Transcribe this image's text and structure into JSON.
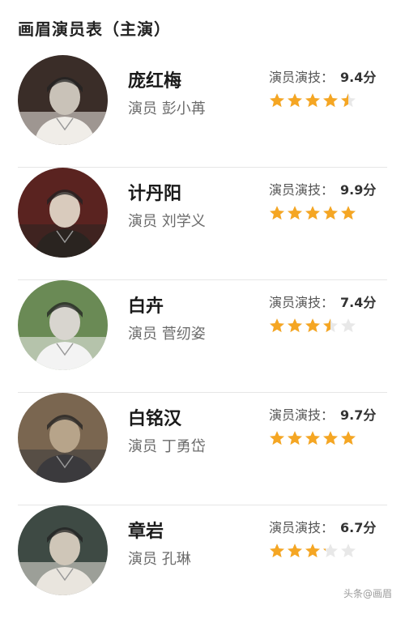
{
  "page": {
    "title": "画眉演员表（主演）"
  },
  "cast": [
    {
      "role": "庞红梅",
      "actor_prefix": "演员",
      "actor": "彭小苒",
      "rating_label": "演员演技：",
      "rating": "9.4分",
      "stars": 4.5,
      "avatar_colors": [
        "#3a2d28",
        "#f0ede8",
        "#c9c2b8"
      ],
      "avatar_icon": "portrait-nurse-icon"
    },
    {
      "role": "计丹阳",
      "actor_prefix": "演员",
      "actor": "刘学义",
      "rating_label": "演员演技：",
      "rating": "9.9分",
      "stars": 5,
      "avatar_colors": [
        "#5a2320",
        "#2a2420",
        "#d9cbbd"
      ],
      "avatar_icon": "portrait-man-icon"
    },
    {
      "role": "白卉",
      "actor_prefix": "演员",
      "actor": "菅纫姿",
      "rating_label": "演员演技：",
      "rating": "7.4分",
      "stars": 3.5,
      "avatar_colors": [
        "#6a8a55",
        "#f3f3f3",
        "#d8d5cf"
      ],
      "avatar_icon": "portrait-nurse-icon"
    },
    {
      "role": "白铭汉",
      "actor_prefix": "演员",
      "actor": "丁勇岱",
      "rating_label": "演员演技：",
      "rating": "9.7分",
      "stars": 5,
      "avatar_colors": [
        "#7a6650",
        "#3b3a3d",
        "#b7a48a"
      ],
      "avatar_icon": "portrait-man-icon"
    },
    {
      "role": "章岩",
      "actor_prefix": "演员",
      "actor": "孔琳",
      "rating_label": "演员演技：",
      "rating": "6.7分",
      "stars": 3.2,
      "avatar_colors": [
        "#3e4a44",
        "#e9e5de",
        "#cfc6b8"
      ],
      "avatar_icon": "portrait-person-icon"
    }
  ],
  "colors": {
    "star_fill": "#f5a623",
    "star_empty": "#e8e8e8",
    "divider": "#e6e6e6"
  },
  "watermark": "头条@画眉"
}
